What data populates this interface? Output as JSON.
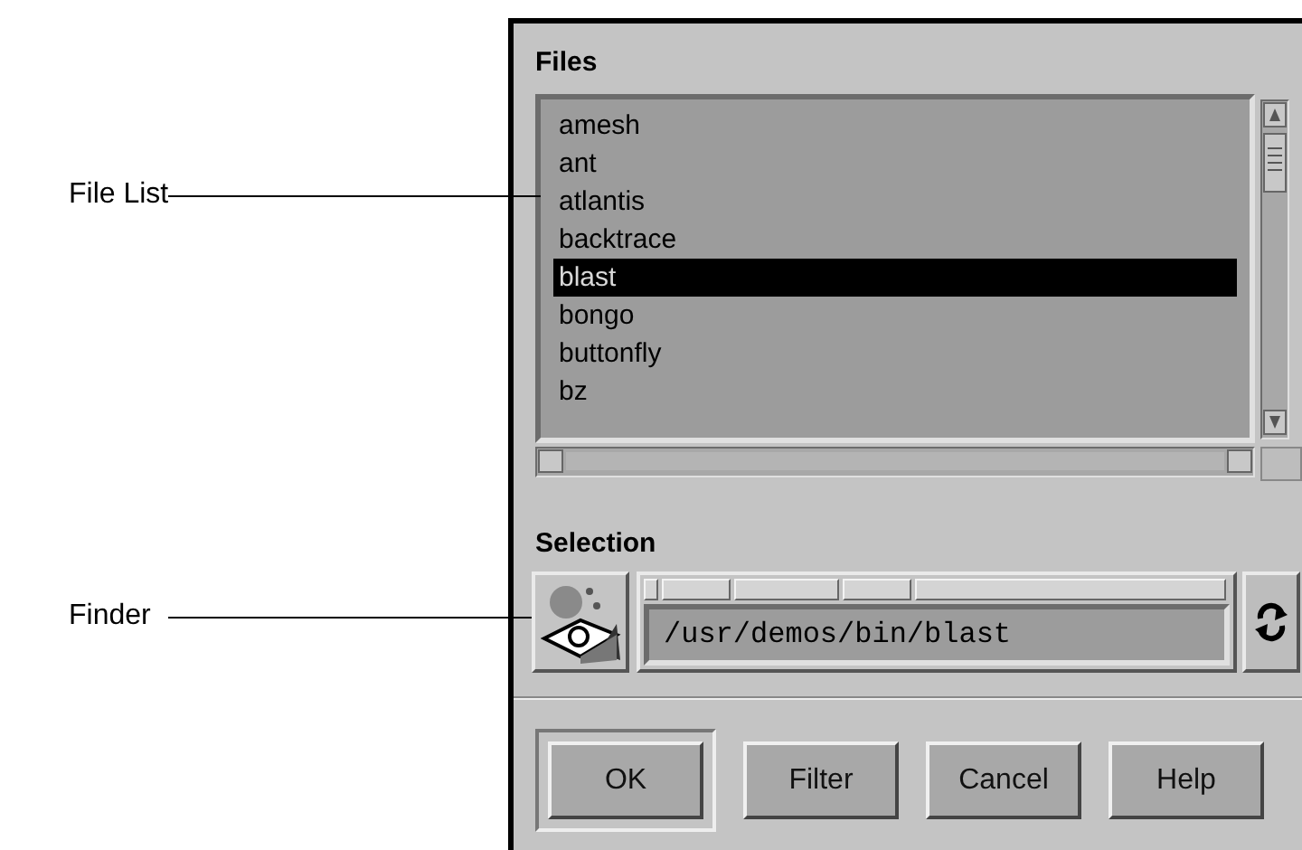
{
  "callouts": [
    {
      "label": "File List"
    },
    {
      "label": "Finder"
    }
  ],
  "files": {
    "label": "Files",
    "items": [
      {
        "name": "amesh",
        "selected": false
      },
      {
        "name": "ant",
        "selected": false
      },
      {
        "name": "atlantis",
        "selected": false
      },
      {
        "name": "backtrace",
        "selected": false
      },
      {
        "name": "blast",
        "selected": true
      },
      {
        "name": "bongo",
        "selected": false
      },
      {
        "name": "buttonfly",
        "selected": false
      },
      {
        "name": "bz",
        "selected": false
      }
    ]
  },
  "selection": {
    "label": "Selection",
    "path": "/usr/demos/bin/blast"
  },
  "buttons": [
    {
      "label": "OK",
      "default": true
    },
    {
      "label": "Filter",
      "default": false
    },
    {
      "label": "Cancel",
      "default": false
    },
    {
      "label": "Help",
      "default": false
    }
  ]
}
